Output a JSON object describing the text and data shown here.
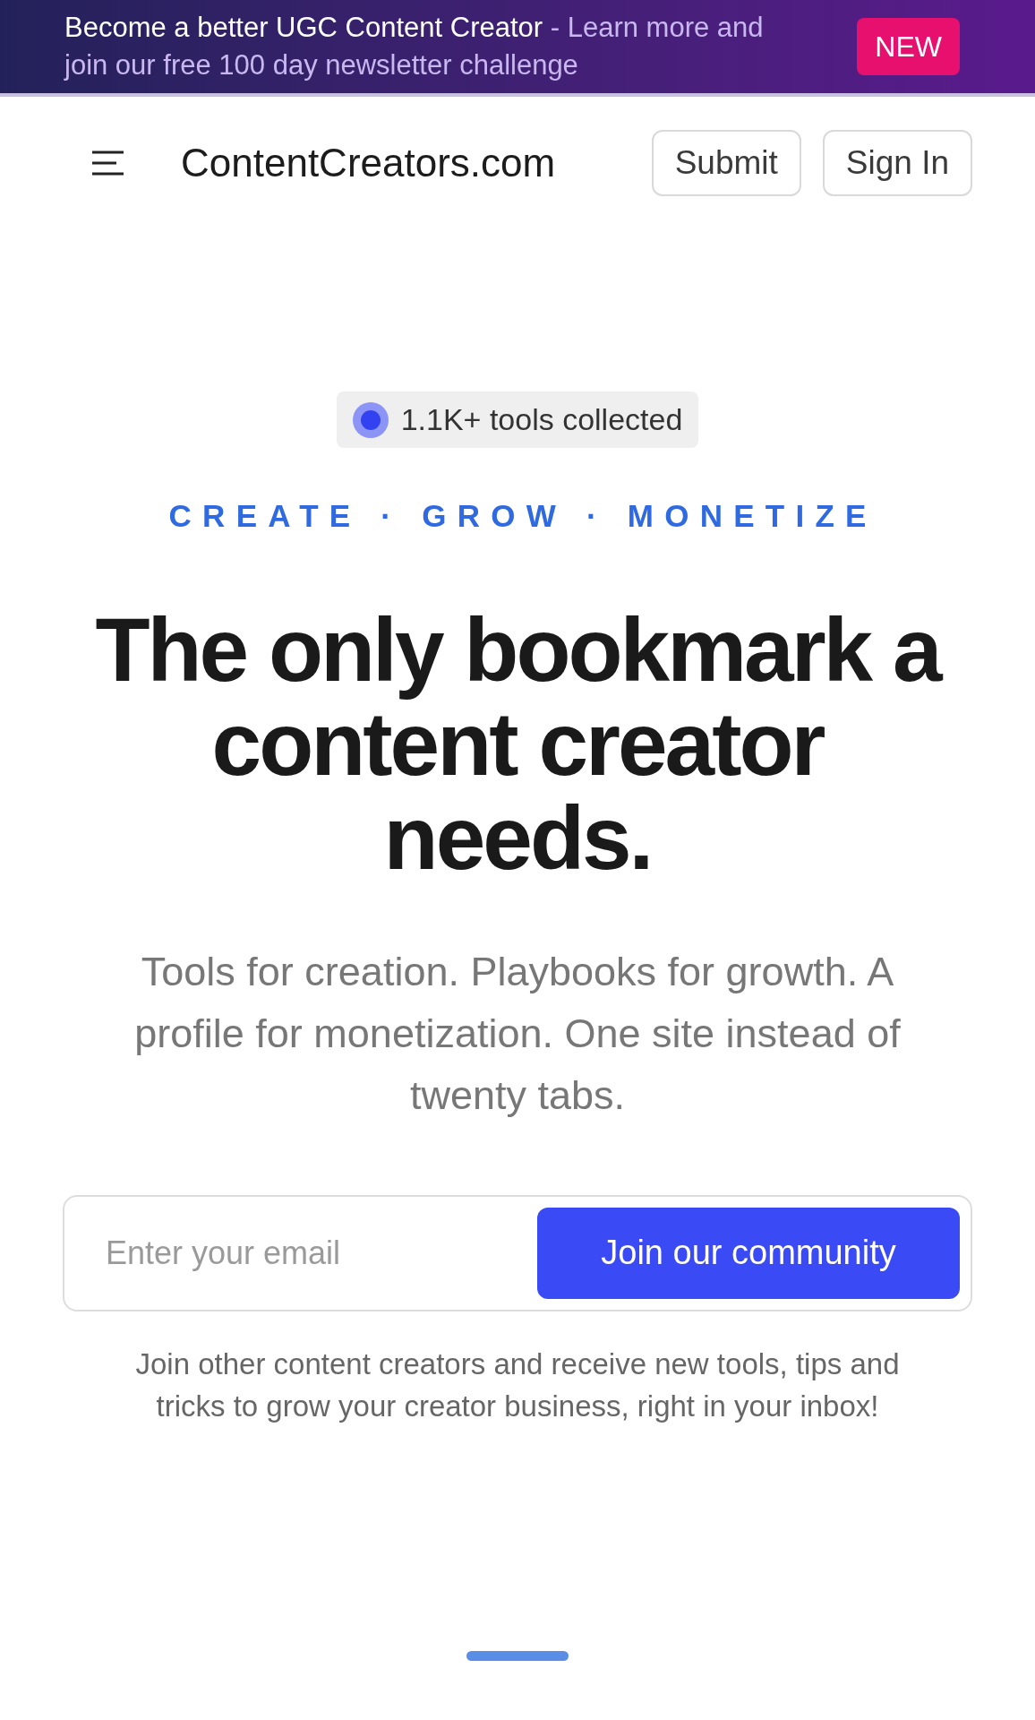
{
  "announcement": {
    "headline": "Become a better UGC Content Creator",
    "detail": "- Learn more and join our free 100 day newsletter challenge",
    "badge": "NEW"
  },
  "nav": {
    "logo": "ContentCreators.com",
    "buttons": [
      "Submit",
      "Sign In"
    ]
  },
  "hero": {
    "pill": "1.1K+ tools collected",
    "tagline": "CREATE · GROW · MONETIZE",
    "heading": "The only bookmark a content creator needs.",
    "subheading": "Tools for creation. Playbooks for growth. A profile for monetization. One site instead of twenty tabs."
  },
  "signup": {
    "placeholder": "Enter your email",
    "button": "Join our community",
    "note": "Join other content creators and receive new tools, tips and tricks to grow your creator business, right in your inbox!"
  }
}
